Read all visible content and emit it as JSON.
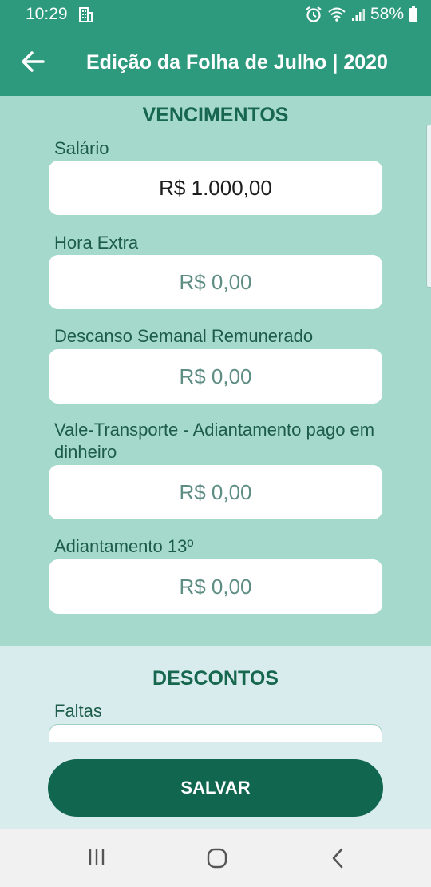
{
  "status": {
    "time": "10:29",
    "battery": "58%"
  },
  "header": {
    "title": "Edição da Folha de Julho | 2020",
    "back_icon": "arrow-left-icon"
  },
  "vencimentos": {
    "title": "VENCIMENTOS",
    "fields": [
      {
        "label": "Salário",
        "value": "R$ 1.000,00"
      },
      {
        "label": "Hora Extra",
        "value": "R$ 0,00"
      },
      {
        "label": "Descanso Semanal Remunerado",
        "value": "R$ 0,00"
      },
      {
        "label": "Vale-Transporte - Adiantamento pago em dinheiro",
        "value": "R$ 0,00"
      },
      {
        "label": "Adiantamento 13º",
        "value": "R$ 0,00"
      }
    ]
  },
  "descontos": {
    "title": "DESCONTOS",
    "fields": [
      {
        "label": "Faltas"
      }
    ]
  },
  "actions": {
    "save_label": "SALVAR"
  },
  "colors": {
    "primary": "#2e9a7d",
    "dark": "#11664f",
    "section_bg": "#a5d9cb",
    "alt_bg": "#d8ecee"
  }
}
